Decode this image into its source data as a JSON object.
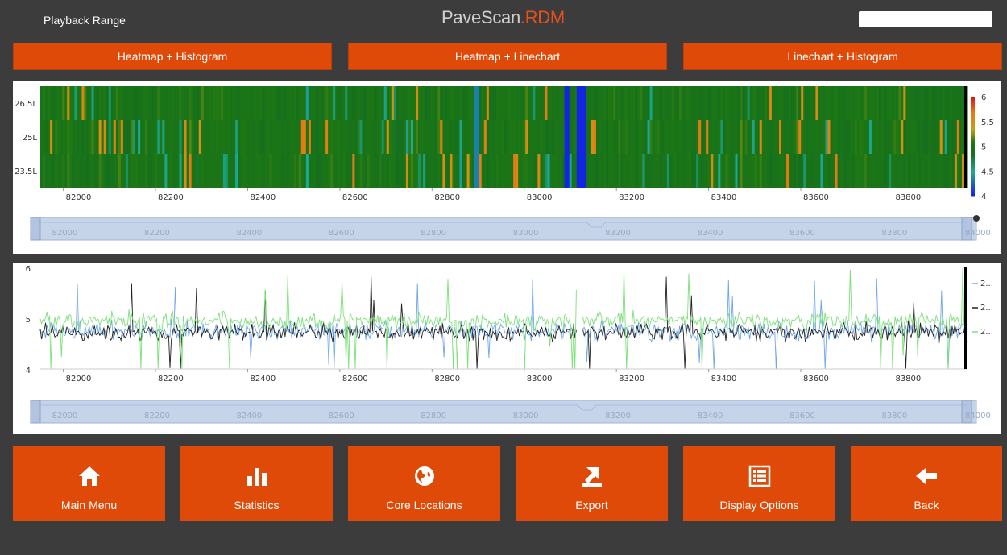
{
  "header": {
    "title": "Playback Range",
    "brand_main": "PaveScan",
    "brand_dot": ".",
    "brand_suffix": "RDM",
    "search": {
      "value": "",
      "placeholder": ""
    }
  },
  "view_buttons": [
    "Heatmap + Histogram",
    "Heatmap + Linechart",
    "Linechart + Histogram"
  ],
  "nav_buttons": [
    {
      "label": "Main Menu",
      "icon": "home-icon"
    },
    {
      "label": "Statistics",
      "icon": "bar-chart-icon"
    },
    {
      "label": "Core Locations",
      "icon": "globe-icon"
    },
    {
      "label": "Export",
      "icon": "export-icon"
    },
    {
      "label": "Display Options",
      "icon": "list-icon"
    },
    {
      "label": "Back",
      "icon": "arrow-left-icon"
    }
  ],
  "colors": {
    "accent": "#e04a08",
    "background": "#3c3c3c",
    "navigator": "#c6d4ea"
  },
  "chart_data": [
    {
      "type": "heatmap",
      "x_range": [
        81950,
        83960
      ],
      "x_ticks": [
        82000,
        82200,
        82400,
        82600,
        82800,
        83000,
        83200,
        83400,
        83600,
        83800
      ],
      "x_tick_labels": [
        "82000",
        "82200",
        "82400",
        "82600",
        "82800",
        "83000",
        "83200",
        "83400",
        "83600",
        "83800"
      ],
      "rows": [
        "26.5L",
        "25L",
        "23.5L"
      ],
      "colorbar": {
        "min": 4,
        "max": 6,
        "ticks": [
          "6",
          "5.5",
          "5",
          "4.5",
          "4"
        ]
      },
      "typical_value": 5.0,
      "low_value_bands_x": [
        82895,
        83090,
        83120
      ],
      "navigator": {
        "ticks": [
          "82000",
          "82200",
          "82400",
          "82600",
          "82800",
          "83000",
          "83200",
          "83400",
          "83600",
          "83800",
          "84000"
        ]
      }
    },
    {
      "type": "line",
      "x_range": [
        81950,
        83960
      ],
      "ylim": [
        4,
        6
      ],
      "y_ticks": [
        "6",
        "5",
        "4"
      ],
      "x_tick_labels": [
        "82000",
        "82200",
        "82400",
        "82600",
        "82800",
        "83000",
        "83200",
        "83400",
        "83600",
        "83800"
      ],
      "gap_x": 83120,
      "series": [
        {
          "name": "2...",
          "color": "#6fa8e8",
          "mean": 4.75,
          "noise": 0.3
        },
        {
          "name": "2...",
          "color": "#222222",
          "mean": 4.72,
          "noise": 0.28
        },
        {
          "name": "2...",
          "color": "#7ee07a",
          "mean": 4.95,
          "noise": 0.28
        }
      ],
      "navigator": {
        "ticks": [
          "82000",
          "82200",
          "82400",
          "82600",
          "82800",
          "83000",
          "83200",
          "83400",
          "83600",
          "83800",
          "84000"
        ]
      }
    }
  ]
}
